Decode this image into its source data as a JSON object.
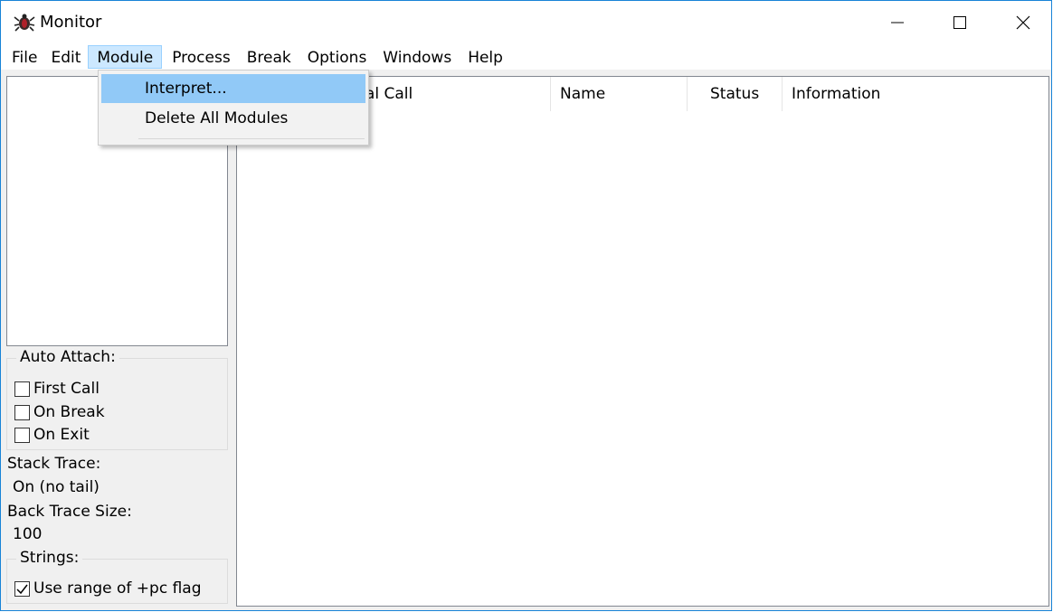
{
  "window": {
    "title": "Monitor",
    "app_icon": "insect-app-icon"
  },
  "menu": {
    "items": [
      {
        "label": "File"
      },
      {
        "label": "Edit"
      },
      {
        "label": "Module",
        "active": true
      },
      {
        "label": "Process"
      },
      {
        "label": "Break"
      },
      {
        "label": "Options"
      },
      {
        "label": "Windows"
      },
      {
        "label": "Help"
      }
    ]
  },
  "module_menu": {
    "items": [
      {
        "label": "Interpret...",
        "highlighted": true
      },
      {
        "label": "Delete All Modules"
      }
    ]
  },
  "auto_attach": {
    "title": "Auto Attach:",
    "options": [
      {
        "label": "First Call",
        "checked": false
      },
      {
        "label": "On Break",
        "checked": false
      },
      {
        "label": "On Exit",
        "checked": false
      }
    ]
  },
  "stack_trace": {
    "label": "Stack Trace:",
    "value": "On (no tail)"
  },
  "back_trace": {
    "label": "Back Trace Size:",
    "value": "100"
  },
  "strings": {
    "title": "Strings:",
    "option": {
      "label": "Use range of +pc flag",
      "checked": true
    }
  },
  "process_table": {
    "columns": [
      "Initial Call",
      "Name",
      "Status",
      "Information"
    ]
  },
  "colors": {
    "highlight": "#91c9f7",
    "menu_active": "#cce8ff",
    "border": "#1883d7"
  }
}
